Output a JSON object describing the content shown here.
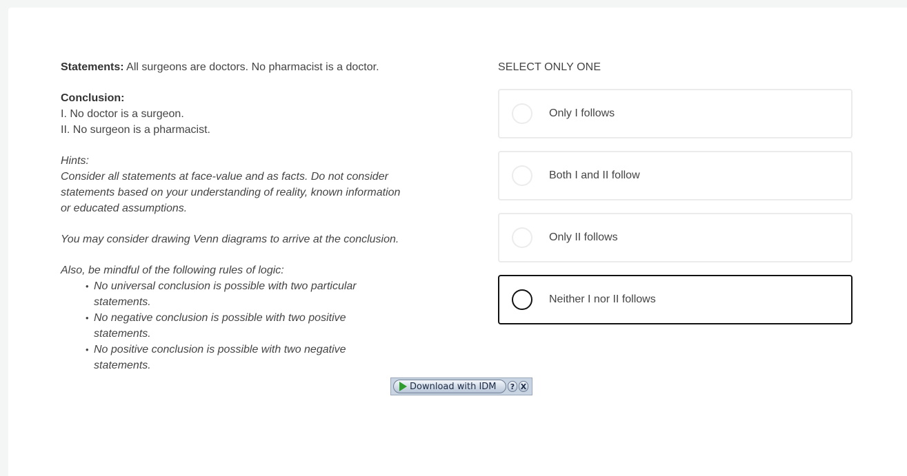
{
  "question": {
    "statements_label": "Statements:",
    "statements_text": "All surgeons are doctors. No pharmacist is a doctor.",
    "conclusion_label": "Conclusion:",
    "conclusions": [
      "I. No doctor is a surgeon.",
      "II. No surgeon is a pharmacist."
    ],
    "hints_label": "Hints:",
    "hints_text": "Consider all statements at face-value and as facts. Do not consider statements based on your understanding of reality, known information or educated assumptions.",
    "venn_text": "You may consider drawing Venn diagrams to arrive at the conclusion.",
    "rules_intro": "Also, be mindful of the following rules of logic:",
    "rules": [
      "No universal conclusion is possible with two particular statements.",
      "No negative conclusion is possible with two positive statements.",
      "No positive conclusion is possible with two negative statements."
    ]
  },
  "answer": {
    "select_label": "SELECT ONLY ONE",
    "options": [
      {
        "label": "Only I follows",
        "selected": false
      },
      {
        "label": "Both I and II follow",
        "selected": false
      },
      {
        "label": "Only II follows",
        "selected": false
      },
      {
        "label": "Neither I nor II follows",
        "selected": true
      }
    ]
  },
  "idm_bar": {
    "download_label": "Download with IDM",
    "help_label": "?",
    "close_label": "X"
  }
}
